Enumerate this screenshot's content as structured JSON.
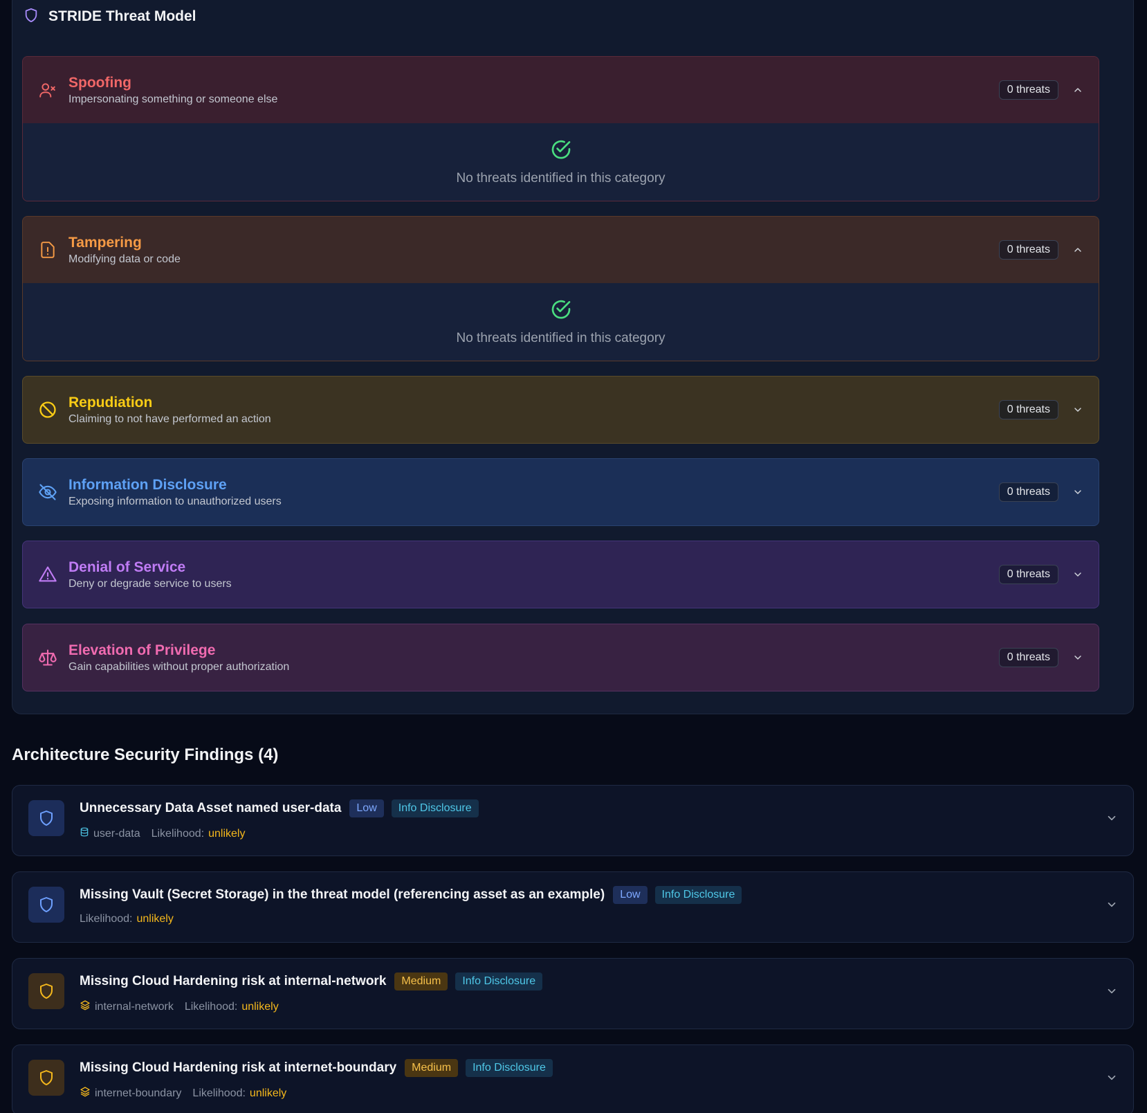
{
  "stride": {
    "title": "STRIDE Threat Model",
    "empty_message": "No threats identified in this category",
    "categories": [
      {
        "title": "Spoofing",
        "desc": "Impersonating something or someone else",
        "badge": "0 threats",
        "icon": "user-x-icon",
        "expanded": true,
        "color": "#f06767",
        "bg": "#3a1f2f"
      },
      {
        "title": "Tampering",
        "desc": "Modifying data or code",
        "badge": "0 threats",
        "icon": "file-alert-icon",
        "expanded": true,
        "color": "#f59a45",
        "bg": "#3b2928"
      },
      {
        "title": "Repudiation",
        "desc": "Claiming to not have performed an action",
        "badge": "0 threats",
        "icon": "ban-icon",
        "expanded": false,
        "color": "#facc15",
        "bg": "#3b3322"
      },
      {
        "title": "Information Disclosure",
        "desc": "Exposing information to unauthorized users",
        "badge": "0 threats",
        "icon": "eye-off-icon",
        "expanded": false,
        "color": "#5ea1f5",
        "bg": "#1b2f57"
      },
      {
        "title": "Denial of Service",
        "desc": "Deny or degrade service to users",
        "badge": "0 threats",
        "icon": "warning-triangle-icon",
        "expanded": false,
        "color": "#c07cf5",
        "bg": "#2f2454"
      },
      {
        "title": "Elevation of Privilege",
        "desc": "Gain capabilities without proper authorization",
        "badge": "0 threats",
        "icon": "scale-icon",
        "expanded": false,
        "color": "#f06bb0",
        "bg": "#382242"
      }
    ]
  },
  "findings": {
    "title": "Architecture Security Findings (4)",
    "items": [
      {
        "title": "Unnecessary Data Asset named user-data",
        "severity": "Low",
        "severity_class": "low",
        "category": "Info Disclosure",
        "asset": "user-data",
        "asset_icon": "database-icon",
        "likelihood_label": "Likelihood:",
        "likelihood": "unlikely"
      },
      {
        "title": "Missing Vault (Secret Storage) in the threat model (referencing asset as an example)",
        "severity": "Low",
        "severity_class": "low",
        "category": "Info Disclosure",
        "asset": "",
        "asset_icon": "",
        "likelihood_label": "Likelihood:",
        "likelihood": "unlikely"
      },
      {
        "title": "Missing Cloud Hardening risk at internal-network",
        "severity": "Medium",
        "severity_class": "medium",
        "category": "Info Disclosure",
        "asset": "internal-network",
        "asset_icon": "layers-icon",
        "likelihood_label": "Likelihood:",
        "likelihood": "unlikely"
      },
      {
        "title": "Missing Cloud Hardening risk at internet-boundary",
        "severity": "Medium",
        "severity_class": "medium",
        "category": "Info Disclosure",
        "asset": "internet-boundary",
        "asset_icon": "layers-icon",
        "likelihood_label": "Likelihood:",
        "likelihood": "unlikely"
      }
    ]
  }
}
